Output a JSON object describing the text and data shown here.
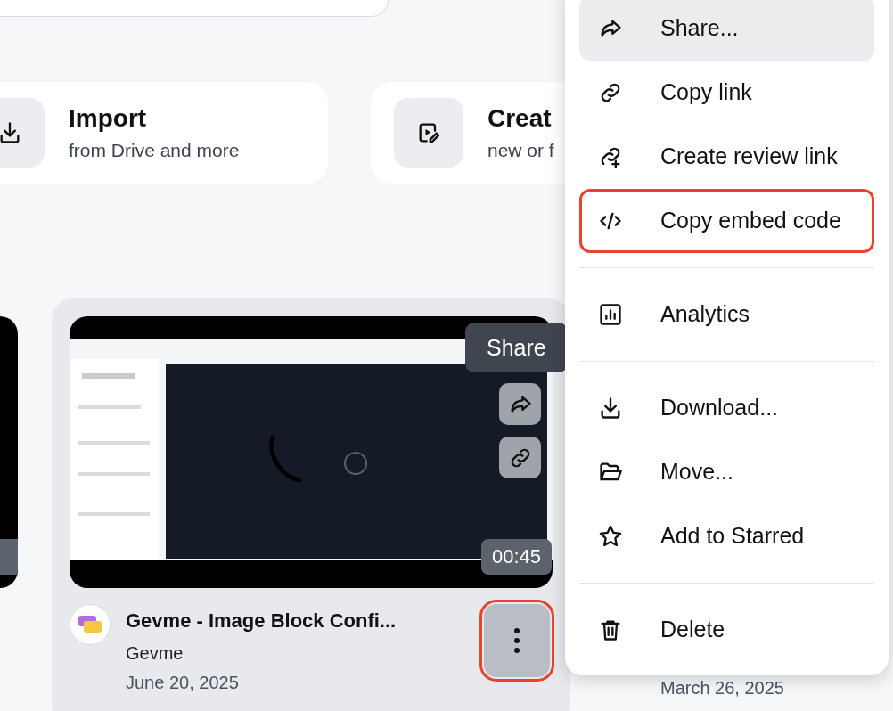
{
  "quick_actions": [
    {
      "title": "Import",
      "subtitle": "from Drive and more"
    },
    {
      "title": "Creat",
      "subtitle": "new or f"
    }
  ],
  "video": {
    "hovered": true,
    "duration": "00:45",
    "title": "Gevme - Image Block Confi...",
    "channel": "Gevme",
    "date": "June 20, 2025",
    "menu_button": {
      "highlighted": true
    }
  },
  "tooltip": {
    "text": "Share"
  },
  "next_video": {
    "date": "March 26, 2025"
  },
  "menu": {
    "sections": [
      [
        {
          "label": "Share...",
          "hovered": true,
          "highlighted": false
        },
        {
          "label": "Copy link",
          "hovered": false,
          "highlighted": false
        },
        {
          "label": "Create review link",
          "hovered": false,
          "highlighted": false
        },
        {
          "label": "Copy embed code",
          "hovered": false,
          "highlighted": true
        }
      ],
      [
        {
          "label": "Analytics",
          "hovered": false,
          "highlighted": false
        }
      ],
      [
        {
          "label": "Download...",
          "hovered": false,
          "highlighted": false
        },
        {
          "label": "Move...",
          "hovered": false,
          "highlighted": false
        },
        {
          "label": "Add to Starred",
          "hovered": false,
          "highlighted": false
        }
      ],
      [
        {
          "label": "Delete",
          "hovered": false,
          "highlighted": false
        }
      ]
    ]
  }
}
